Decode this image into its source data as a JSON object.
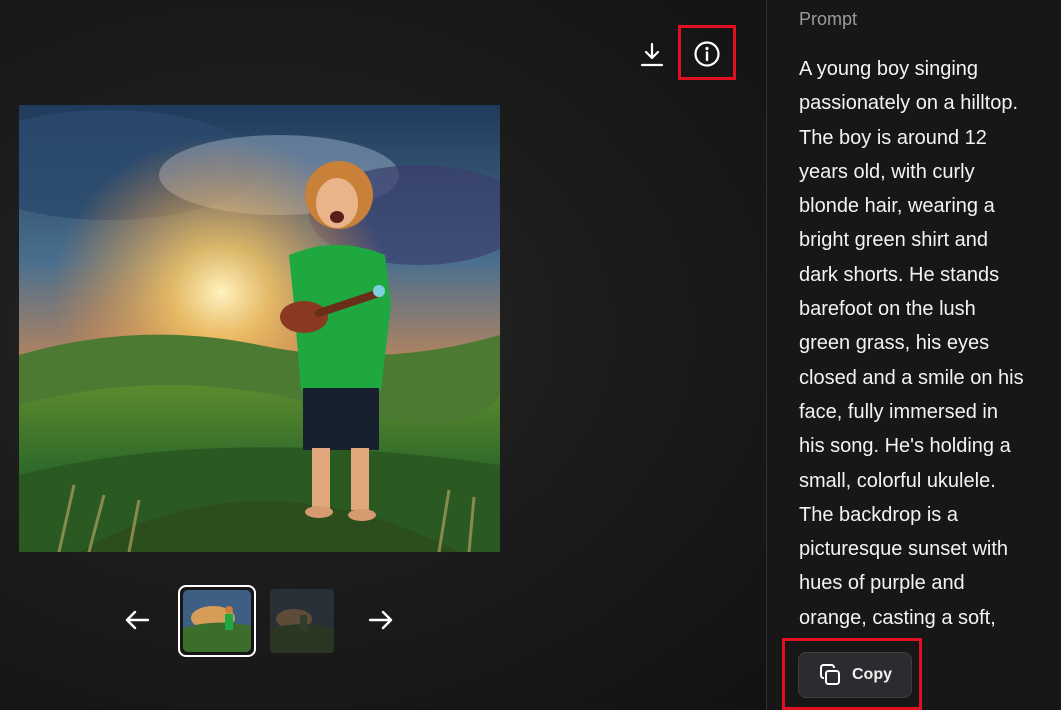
{
  "toolbar": {
    "download_icon": "download-icon",
    "info_icon": "info-icon"
  },
  "gallery": {
    "prev_icon": "arrow-left-icon",
    "next_icon": "arrow-right-icon",
    "selected_index": 1,
    "thumbnail_count": 2
  },
  "prompt": {
    "label": "Prompt",
    "lines": [
      "A young boy singing",
      "passionately on a hilltop.",
      "The boy is around 12",
      "years old, with curly",
      "blonde hair, wearing a",
      "bright green shirt and",
      "dark shorts. He stands",
      "barefoot on the lush",
      "green grass, his eyes",
      "closed and a smile on his",
      "face, fully immersed in",
      "his song. He's holding a",
      "small, colorful ukulele.",
      "The backdrop is a",
      "picturesque sunset with",
      "hues of purple and",
      "orange, casting a soft,"
    ],
    "copy_label": "Copy",
    "copy_icon": "copy-icon"
  },
  "colors": {
    "highlight": "#e01020",
    "background": "#161616",
    "copy_button_bg": "#2c2c30"
  }
}
